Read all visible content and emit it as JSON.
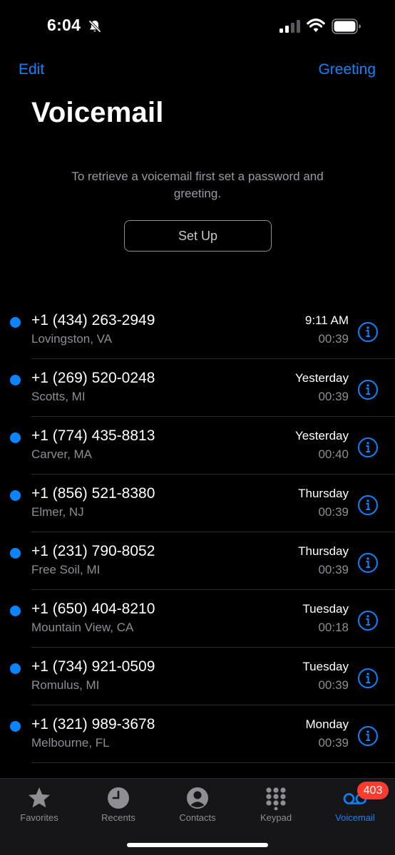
{
  "status_bar": {
    "time": "6:04",
    "silent_icon": "bell-slash-icon",
    "signal_icon": "cellular-signal-icon",
    "wifi_icon": "wifi-icon",
    "battery_icon": "battery-icon"
  },
  "nav": {
    "edit_label": "Edit",
    "greeting_label": "Greeting"
  },
  "page_title": "Voicemail",
  "setup": {
    "message": "To retrieve a voicemail first set a password and greeting.",
    "button_label": "Set Up"
  },
  "voicemails": [
    {
      "number": "+1 (434) 263-2949",
      "location": "Lovingston, VA",
      "when": "9:11 AM",
      "duration": "00:39",
      "unread": true
    },
    {
      "number": "+1 (269) 520-0248",
      "location": "Scotts, MI",
      "when": "Yesterday",
      "duration": "00:39",
      "unread": true
    },
    {
      "number": "+1 (774) 435-8813",
      "location": "Carver, MA",
      "when": "Yesterday",
      "duration": "00:40",
      "unread": true
    },
    {
      "number": "+1 (856) 521-8380",
      "location": "Elmer, NJ",
      "when": "Thursday",
      "duration": "00:39",
      "unread": true
    },
    {
      "number": "+1 (231) 790-8052",
      "location": "Free Soil, MI",
      "when": "Thursday",
      "duration": "00:39",
      "unread": true
    },
    {
      "number": "+1 (650) 404-8210",
      "location": "Mountain View, CA",
      "when": "Tuesday",
      "duration": "00:18",
      "unread": true
    },
    {
      "number": "+1 (734) 921-0509",
      "location": "Romulus, MI",
      "when": "Tuesday",
      "duration": "00:39",
      "unread": true
    },
    {
      "number": "+1 (321) 989-3678",
      "location": "Melbourne, FL",
      "when": "Monday",
      "duration": "00:39",
      "unread": true
    }
  ],
  "tab_bar": {
    "tabs": [
      {
        "label": "Favorites",
        "icon": "star-icon",
        "active": false
      },
      {
        "label": "Recents",
        "icon": "clock-icon",
        "active": false
      },
      {
        "label": "Contacts",
        "icon": "person-circle-icon",
        "active": false
      },
      {
        "label": "Keypad",
        "icon": "keypad-icon",
        "active": false
      },
      {
        "label": "Voicemail",
        "icon": "voicemail-icon",
        "active": true
      }
    ],
    "voicemail_badge": "403"
  },
  "colors": {
    "accent": "#0a84ff",
    "badge": "#ff3b30",
    "background": "#000000",
    "secondary_text": "#8e8e93"
  }
}
